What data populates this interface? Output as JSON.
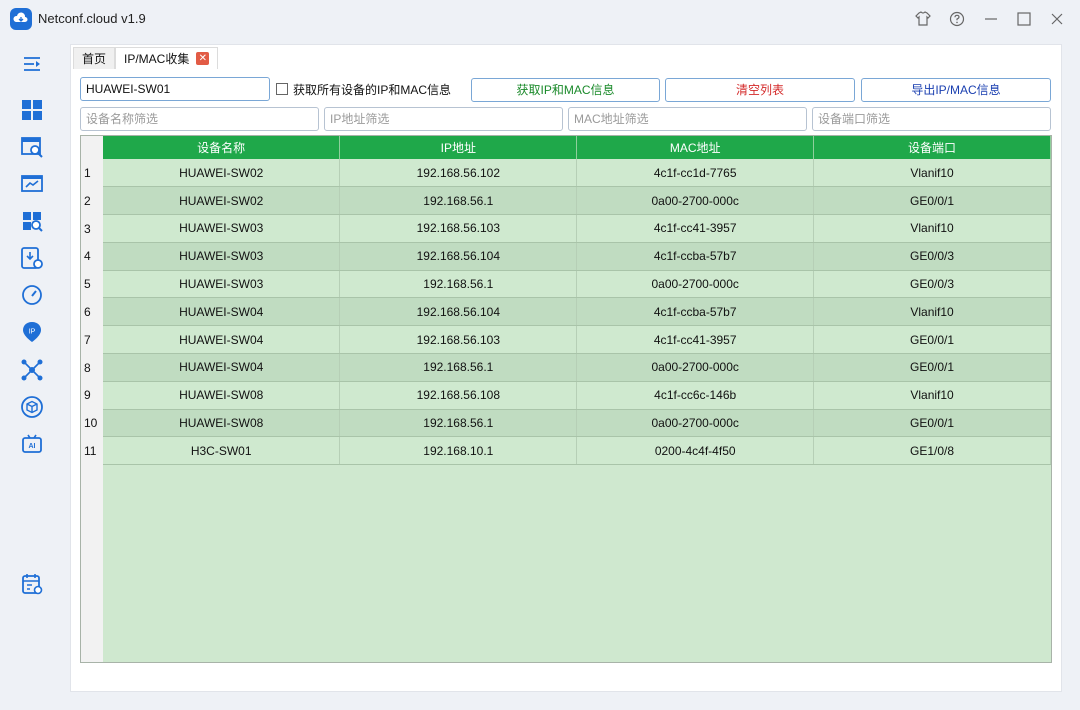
{
  "app": {
    "title": "Netconf.cloud v1.9"
  },
  "tabs": [
    {
      "label": "首页"
    },
    {
      "label": "IP/MAC收集"
    }
  ],
  "toolbar": {
    "device_input_value": "HUAWEI-SW01",
    "checkbox_label": "获取所有设备的IP和MAC信息",
    "fetch_button": "获取IP和MAC信息",
    "clear_button": "清空列表",
    "export_button": "导出IP/MAC信息"
  },
  "filters": {
    "device_placeholder": "设备名称筛选",
    "ip_placeholder": "IP地址筛选",
    "mac_placeholder": "MAC地址筛选",
    "port_placeholder": "设备端口筛选"
  },
  "table": {
    "columns": [
      "设备名称",
      "IP地址",
      "MAC地址",
      "设备端口"
    ],
    "rows": [
      {
        "num": "1",
        "device": "HUAWEI-SW02",
        "ip": "192.168.56.102",
        "mac": "4c1f-cc1d-7765",
        "port": "Vlanif10"
      },
      {
        "num": "2",
        "device": "HUAWEI-SW02",
        "ip": "192.168.56.1",
        "mac": "0a00-2700-000c",
        "port": "GE0/0/1"
      },
      {
        "num": "3",
        "device": "HUAWEI-SW03",
        "ip": "192.168.56.103",
        "mac": "4c1f-cc41-3957",
        "port": "Vlanif10"
      },
      {
        "num": "4",
        "device": "HUAWEI-SW03",
        "ip": "192.168.56.104",
        "mac": "4c1f-ccba-57b7",
        "port": "GE0/0/3"
      },
      {
        "num": "5",
        "device": "HUAWEI-SW03",
        "ip": "192.168.56.1",
        "mac": "0a00-2700-000c",
        "port": "GE0/0/3"
      },
      {
        "num": "6",
        "device": "HUAWEI-SW04",
        "ip": "192.168.56.104",
        "mac": "4c1f-ccba-57b7",
        "port": "Vlanif10"
      },
      {
        "num": "7",
        "device": "HUAWEI-SW04",
        "ip": "192.168.56.103",
        "mac": "4c1f-cc41-3957",
        "port": "GE0/0/1"
      },
      {
        "num": "8",
        "device": "HUAWEI-SW04",
        "ip": "192.168.56.1",
        "mac": "0a00-2700-000c",
        "port": "GE0/0/1"
      },
      {
        "num": "9",
        "device": "HUAWEI-SW08",
        "ip": "192.168.56.108",
        "mac": "4c1f-cc6c-146b",
        "port": "Vlanif10"
      },
      {
        "num": "10",
        "device": "HUAWEI-SW08",
        "ip": "192.168.56.1",
        "mac": "0a00-2700-000c",
        "port": "GE0/0/1"
      },
      {
        "num": "11",
        "device": "H3C-SW01",
        "ip": "192.168.10.1",
        "mac": "0200-4c4f-4f50",
        "port": "GE1/0/8"
      }
    ]
  },
  "sidebar": {
    "icons": [
      "menu-toggle-icon",
      "dashboard-icon",
      "search-list-icon",
      "monitor-icon",
      "inspect-icon",
      "download-config-icon",
      "speed-icon",
      "ip-icon",
      "topology-icon",
      "package-icon",
      "ai-icon",
      "calendar-icon"
    ]
  },
  "colors": {
    "accent": "#1f6fd6",
    "header_green": "#1fa84a",
    "row_green": "#cfe9cf",
    "row_green_alt": "#c0dcc1",
    "fetch_text": "#1a8a2a",
    "clear_text": "#d42a2a",
    "export_text": "#1a3fb0"
  }
}
